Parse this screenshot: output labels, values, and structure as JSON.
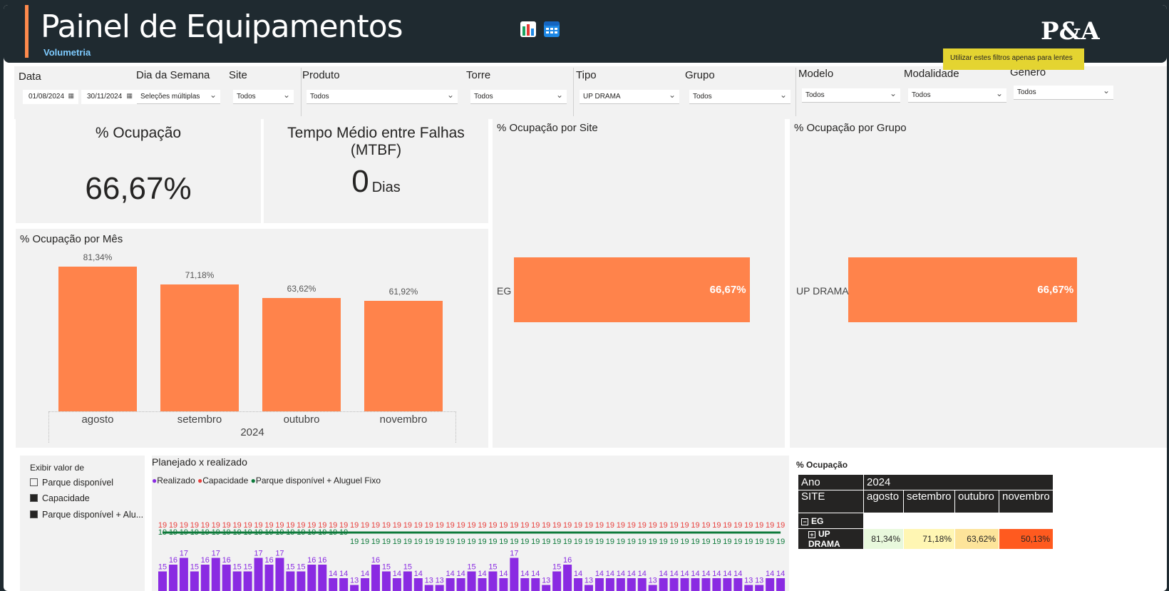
{
  "header": {
    "title": "Painel de Equipamentos",
    "subtitle": "Volumetria",
    "logo": "P&A",
    "icons": [
      "report-icon",
      "calendar-grid-icon"
    ]
  },
  "tooltip": "Utilizar estes filtros apenas para lentes",
  "filters": {
    "data": {
      "label": "Data",
      "start": "01/08/2024",
      "end": "30/11/2024"
    },
    "dia_semana": {
      "label": "Dia da Semana",
      "value": "Seleções múltiplas"
    },
    "site": {
      "label": "Site",
      "value": "Todos"
    },
    "produto": {
      "label": "Produto",
      "value": "Todos"
    },
    "torre": {
      "label": "Torre",
      "value": "Todos"
    },
    "tipo": {
      "label": "Tipo",
      "value": "UP DRAMA"
    },
    "grupo": {
      "label": "Grupo",
      "value": "Todos"
    },
    "modelo": {
      "label": "Modelo",
      "value": "Todos"
    },
    "modalidade": {
      "label": "Modalidade",
      "value": "Todos"
    },
    "genero": {
      "label": "Gênero",
      "value": "Todos"
    }
  },
  "kpis": {
    "ocupacao": {
      "title": "% Ocupação",
      "value": "66,67%"
    },
    "mtbf": {
      "title": "Tempo Médio entre Falhas (MTBF)",
      "value": "0",
      "unit": "Dias"
    }
  },
  "colors": {
    "bar": "#ff834b",
    "realizado": "#8a2be2",
    "capacidade": "#e8423f",
    "parque": "#0e7a3b",
    "dark": "#252423"
  },
  "chart_data": [
    {
      "type": "bar",
      "title": "% Ocupação por Mês",
      "categories": [
        "agosto",
        "setembro",
        "outubro",
        "novembro"
      ],
      "values": [
        81.34,
        71.18,
        63.62,
        61.92
      ],
      "value_labels": [
        "81,34%",
        "71,18%",
        "63,62%",
        "61,92%"
      ],
      "xlabel": "2024",
      "ylim": [
        0,
        100
      ]
    },
    {
      "type": "bar",
      "orientation": "horizontal",
      "title": "% Ocupação por Site",
      "categories": [
        "EG"
      ],
      "values": [
        66.67
      ],
      "value_labels": [
        "66,67%"
      ]
    },
    {
      "type": "bar",
      "orientation": "horizontal",
      "title": "% Ocupação por Grupo",
      "categories": [
        "UP DRAMA"
      ],
      "values": [
        66.67
      ],
      "value_labels": [
        "66,67%"
      ]
    },
    {
      "type": "bar",
      "title": "Planejado x realizado",
      "legend": [
        "Realizado",
        "Capacidade",
        "Parque disponível + Aluguel Fixo"
      ],
      "series": [
        {
          "name": "Realizado",
          "values": [
            15,
            16,
            17,
            15,
            16,
            17,
            16,
            15,
            15,
            17,
            16,
            17,
            15,
            15,
            16,
            16,
            14,
            14,
            13,
            14,
            16,
            15,
            14,
            15,
            14,
            13,
            13,
            14,
            14,
            15,
            14,
            15,
            14,
            17,
            14,
            14,
            13,
            15,
            16,
            14,
            13,
            14,
            14,
            14,
            14,
            14,
            13,
            14,
            14,
            14,
            14,
            14,
            14,
            14,
            14,
            13,
            13,
            14,
            14
          ]
        },
        {
          "name": "Capacidade",
          "values": [
            19,
            19,
            19,
            19,
            19,
            19,
            19,
            19,
            19,
            19,
            19,
            19,
            19,
            19,
            19,
            19,
            19,
            19,
            19,
            19,
            19,
            19,
            19,
            19,
            19,
            19,
            19,
            19,
            19,
            19,
            19,
            19,
            19,
            19,
            19,
            19,
            19,
            19,
            19,
            19,
            19,
            19,
            19,
            19,
            19,
            19,
            19,
            19,
            19,
            19,
            19,
            19,
            19,
            19,
            19,
            19,
            19,
            19,
            19
          ]
        },
        {
          "name": "Parque disponível + Aluguel Fixo",
          "values": [
            19,
            19,
            19,
            19,
            19,
            19,
            19,
            19,
            19,
            19,
            19,
            19,
            19,
            19,
            19,
            19,
            19,
            19,
            19,
            19,
            19,
            19,
            19,
            19,
            19,
            19,
            19,
            19,
            19,
            19,
            19,
            19,
            19,
            19,
            19,
            19,
            19,
            19,
            19,
            19,
            19,
            19,
            19,
            19,
            19,
            19,
            19,
            19,
            19,
            19,
            19,
            19,
            19,
            19,
            19,
            19,
            19,
            19,
            19
          ]
        }
      ]
    }
  ],
  "legend_panel": {
    "title": "Exibir valor de",
    "items": [
      {
        "label": "Parque disponível",
        "checked": false
      },
      {
        "label": "Capacidade",
        "checked": true
      },
      {
        "label": "Parque disponível + Alu...",
        "checked": true
      }
    ]
  },
  "matrix": {
    "title": "% Ocupação",
    "ano_label": "Ano",
    "ano_value": "2024",
    "site_label": "SITE",
    "months": [
      "agosto",
      "setembro",
      "outubro",
      "novembro"
    ],
    "group": "EG",
    "row_label": "UP DRAMA",
    "row_values": [
      "81,34%",
      "71,18%",
      "63,62%",
      "50,13%"
    ],
    "row_colors": [
      "#e8f8dc",
      "#fff6b3",
      "#fde49a",
      "#ff5a1f"
    ]
  }
}
